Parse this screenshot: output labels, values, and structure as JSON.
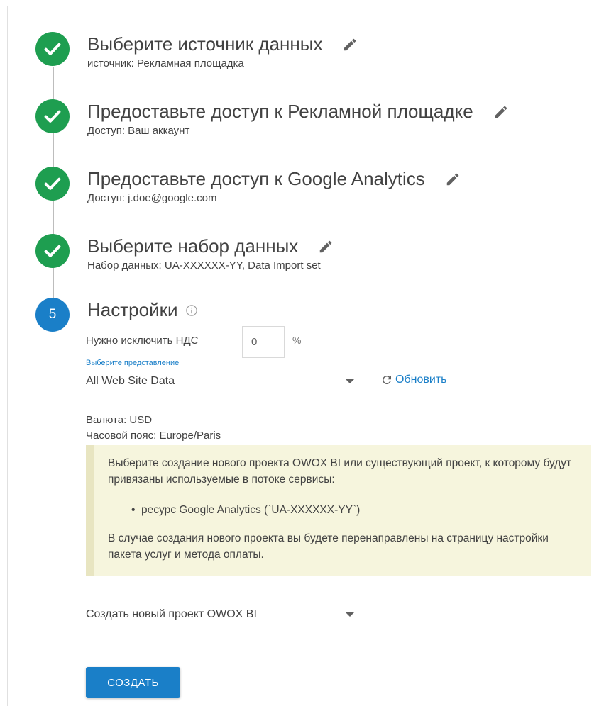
{
  "steps": [
    {
      "title": "Выберите источник данных",
      "subtitle": "источник: Рекламная площадка",
      "edit_icon": "pencil-icon",
      "status_icon": "check-icon"
    },
    {
      "title": "Предоставьте доступ к Рекламной площадке",
      "subtitle": "Доступ: Ваш аккаунт",
      "edit_icon": "pencil-icon",
      "status_icon": "check-icon"
    },
    {
      "title": "Предоставьте доступ к Google Analytics",
      "subtitle": "Доступ: j.doe@google.com",
      "edit_icon": "pencil-icon",
      "status_icon": "check-icon"
    },
    {
      "title": "Выберите набор данных",
      "subtitle": "Набор данных: UA-XXXXXX-YY, Data Import set",
      "edit_icon": "pencil-icon",
      "status_icon": "check-icon"
    }
  ],
  "settings": {
    "step_number": "5",
    "title": "Настройки",
    "info_icon": "info-icon",
    "vat_label": "Нужно исключить НДС",
    "vat_value": "0",
    "vat_unit": "%",
    "view_caption": "Выберите представление",
    "view_value": "All Web Site Data",
    "refresh_label": "Обновить",
    "currency": "Валюта: USD",
    "timezone": "Часовой пояс: Europe/Paris",
    "notice": {
      "paragraph1": "Выберите создание нового проекта OWOX BI или существующий проект, к которому будут привязаны используемые в потоке сервисы:",
      "bullet": "ресурс Google Analytics (`UA-XXXXXX-YY`)",
      "paragraph2": "В случае создания нового проекта вы будете перенаправлены на страницу настройки пакета услуг и метода оплаты."
    },
    "project_value": "Создать новый проект OWOX BI",
    "create_label": "СОЗДАТЬ"
  },
  "colors": {
    "done": "#1e9e50",
    "active": "#1a7fc8",
    "notice_bg": "#f6f5dd",
    "notice_border": "#e8e5c1"
  }
}
